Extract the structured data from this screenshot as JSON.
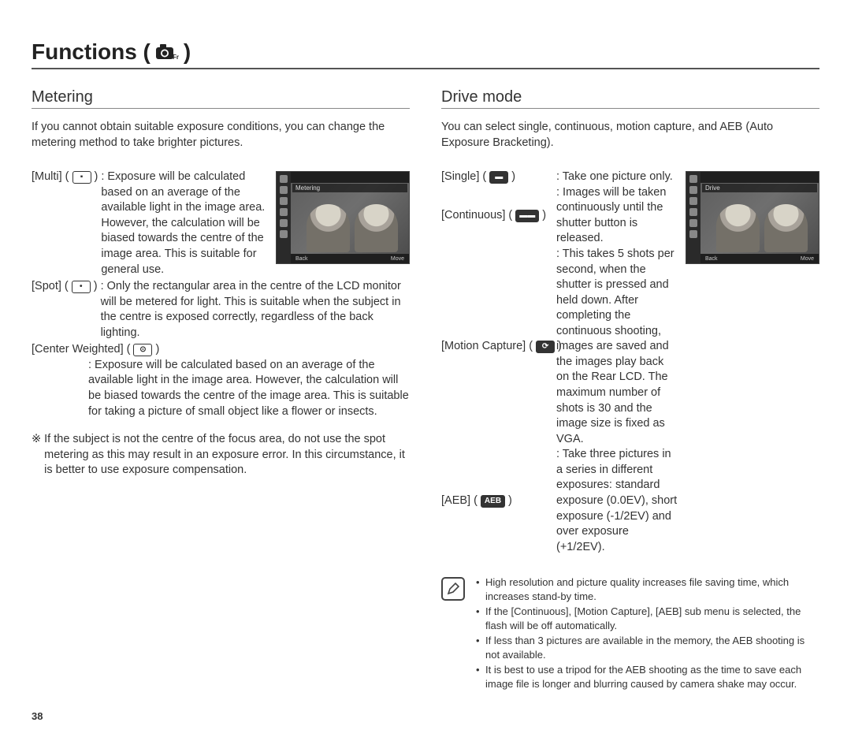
{
  "page": {
    "title_prefix": "Functions (",
    "title_suffix": " )",
    "number": "38"
  },
  "left": {
    "heading": "Metering",
    "intro": "If you cannot obtain suitable exposure conditions, you can change the metering method to take brighter pictures.",
    "screenshot": {
      "label": "Metering",
      "back": "Back",
      "move": "Move"
    },
    "multi": {
      "label": "[Multi]",
      "text": ": Exposure will be calculated based on an average of the available light in the image area. However, the calculation will be biased towards the centre of the image area. This is suitable for general use."
    },
    "spot": {
      "label": "[Spot]",
      "text": ": Only the rectangular area in the centre of the LCD monitor will be metered for light. This is suitable when the subject in the centre is exposed correctly, regardless of the back lighting."
    },
    "center": {
      "label": "[Center Weighted]",
      "text": ": Exposure will be calculated based on an average of the available light in the image area. However, the calculation will be biased towards the centre of the image area. This is suitable for taking a picture of small object like a flower or insects."
    },
    "note": {
      "sym": "※",
      "text": "If the subject is not the centre of the focus area, do not use the spot metering as this may result in an exposure error. In this circumstance, it is better to use exposure compensation."
    }
  },
  "right": {
    "heading": "Drive mode",
    "intro": "You can select single, continuous, motion capture, and AEB (Auto Exposure Bracketing).",
    "screenshot": {
      "label": "Drive",
      "back": "Back",
      "move": "Move"
    },
    "single": {
      "label": "[Single]",
      "text": ": Take one picture only."
    },
    "continuous": {
      "label": "[Continuous]",
      "text": ": Images will be taken continuously until the shutter button is released."
    },
    "motion": {
      "label": "[Motion Capture]",
      "text": ": This takes 5 shots per second, when the shutter is pressed and held down. After completing the continuous shooting, images are saved and the images play back on the Rear LCD. The maximum number of shots is 30 and the image size is fixed as VGA."
    },
    "aeb": {
      "label": "[AEB]",
      "text": ": Take three pictures in a series in different exposures: standard exposure (0.0EV), short exposure (-1/2EV) and over exposure (+1/2EV)."
    },
    "tips": [
      "High resolution and picture quality increases file saving time, which increases stand-by time.",
      "If the [Continuous], [Motion Capture], [AEB] sub menu is selected, the flash will be off automatically.",
      "If less than 3 pictures are available in the memory, the AEB shooting is not available.",
      "It is best to use a tripod for the AEB shooting as the time to save each image file is longer and blurring caused by camera shake may occur."
    ]
  }
}
